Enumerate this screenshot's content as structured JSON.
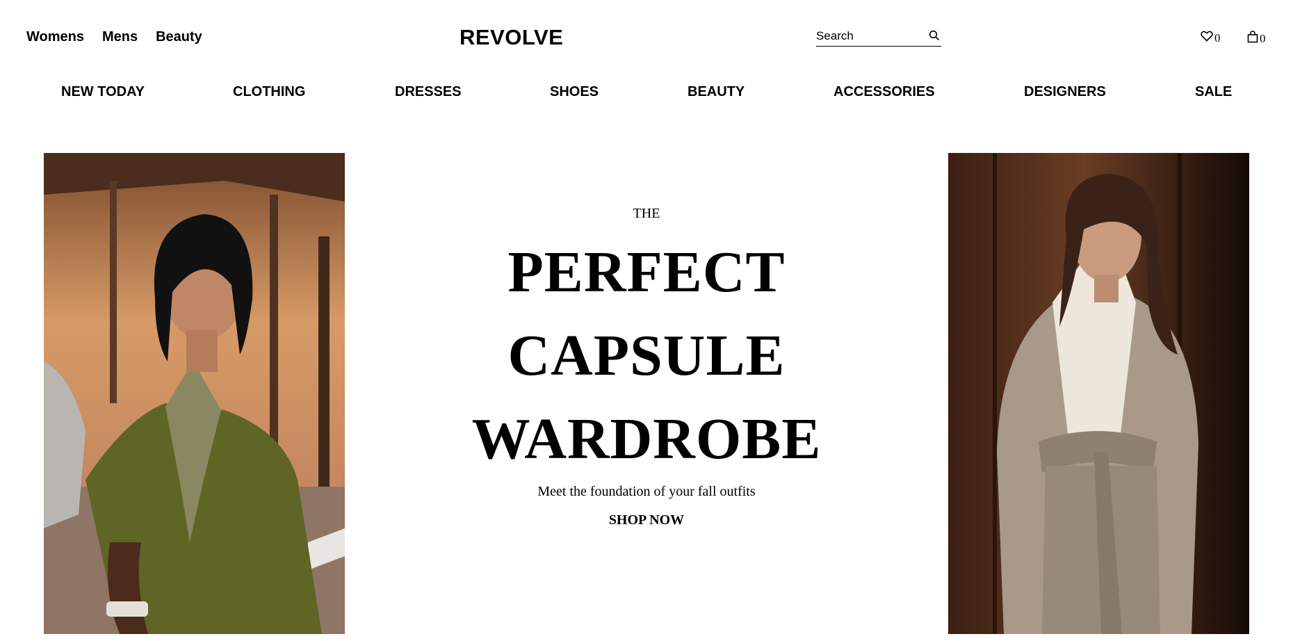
{
  "header": {
    "gender_nav": [
      "Womens",
      "Mens",
      "Beauty"
    ],
    "logo": "REVOLVE",
    "search": {
      "placeholder": "Search"
    },
    "wishlist_count": "0",
    "bag_count": "0"
  },
  "category_nav": [
    "NEW TODAY",
    "CLOTHING",
    "DRESSES",
    "SHOES",
    "BEAUTY",
    "ACCESSORIES",
    "DESIGNERS",
    "SALE"
  ],
  "hero": {
    "eyebrow": "THE",
    "headline_lines": [
      "PERFECT",
      "CAPSULE",
      "WARDROBE"
    ],
    "subtext": "Meet the foundation of your fall outfits",
    "cta": "SHOP NOW"
  },
  "colors": {
    "text": "#000000",
    "background": "#ffffff"
  }
}
